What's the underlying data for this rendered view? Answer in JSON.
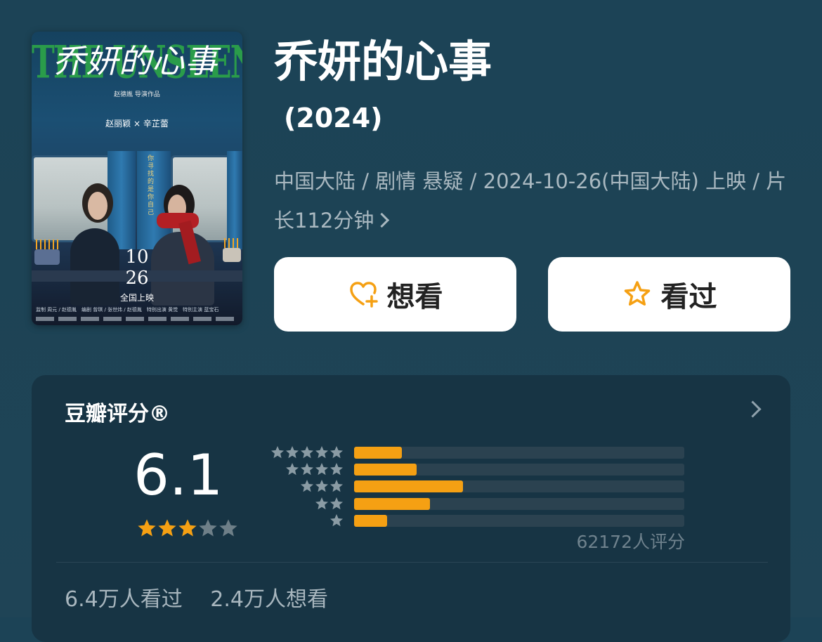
{
  "poster": {
    "title_art": "乔妍的心事",
    "english_title": "THE UNSEEN SISTER",
    "director_line": "赵德胤 导演作品",
    "cast_line": "赵丽颖 × 辛芷蕾",
    "vertical_text": "你寻找的是你自己",
    "date_line1": "10",
    "date_line2": "26",
    "release_line": "全国上映",
    "credits_line": "监制 周元 / 赵德胤　编剧 曾琪 / 张世炜 / 赵德胤　特别出演 黄觉　特别主演 蓝宝石"
  },
  "movie": {
    "title": "乔妍的心事",
    "year": "(2024)",
    "meta_text": "中国大陆 / 剧情 悬疑 / 2024-10-26(中国大陆) 上映 / 片长112分钟"
  },
  "actions": {
    "want_label": "想看",
    "want_icon": "heart-plus-icon",
    "seen_label": "看过",
    "seen_icon": "star-outline-icon",
    "accent_color": "#f5a013"
  },
  "rating": {
    "section_title": "豆瓣评分®",
    "score": "6.1",
    "score_stars_filled": 3,
    "score_stars_total": 5,
    "distribution": [
      {
        "stars": 5,
        "fraction": 0.145
      },
      {
        "stars": 4,
        "fraction": 0.19
      },
      {
        "stars": 3,
        "fraction": 0.33
      },
      {
        "stars": 2,
        "fraction": 0.23
      },
      {
        "stars": 1,
        "fraction": 0.1
      }
    ],
    "count_text": "62172人评分",
    "seen_text": "6.4万人看过",
    "want_text": "2.4万人想看",
    "star_color": "#f5a013",
    "empty_star_color": "#6e7f88"
  }
}
